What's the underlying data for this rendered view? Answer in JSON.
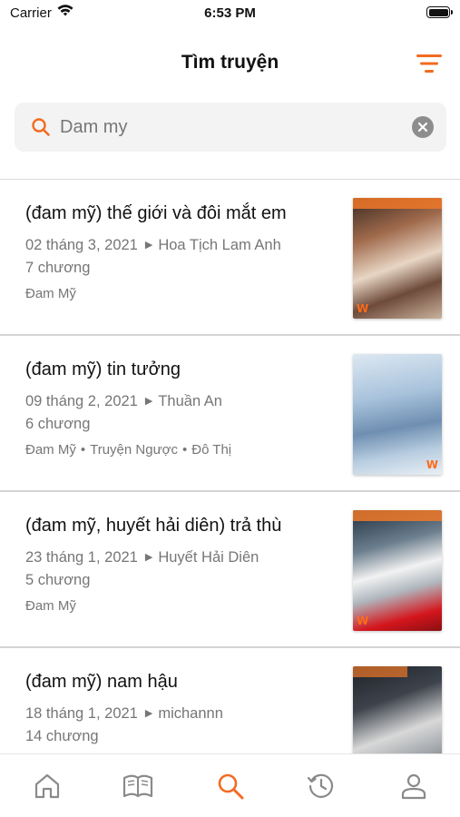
{
  "status_bar": {
    "carrier": "Carrier",
    "time": "6:53 PM"
  },
  "header": {
    "title": "Tìm truyện",
    "filter_icon": "filter-lines-icon"
  },
  "search": {
    "query": "Dam my",
    "placeholder": "Tìm truyện",
    "search_icon": "search-icon",
    "clear_icon": "clear-icon"
  },
  "results": [
    {
      "title": "(đam mỹ) thế giới và đôi mắt em",
      "date": "02 tháng 3, 2021",
      "author": "Hoa Tịch Lam Anh",
      "chapters": "7 chương",
      "tags": [
        "Đam Mỹ"
      ]
    },
    {
      "title": "(đam mỹ) tin tưởng",
      "date": "09 tháng 2, 2021",
      "author": "Thuần An",
      "chapters": "6 chương",
      "tags": [
        "Đam Mỹ",
        "Truyện Ngược",
        "Đô Thị"
      ]
    },
    {
      "title": "(đam mỹ, huyết hải diên) trả thù",
      "date": "23 tháng 1, 2021",
      "author": "Huyết Hải Diên",
      "chapters": "5 chương",
      "tags": [
        "Đam Mỹ"
      ]
    },
    {
      "title": "(đam mỹ) nam hậu",
      "date": "18 tháng 1, 2021",
      "author": "michannn",
      "chapters": "14 chương",
      "tags": []
    }
  ],
  "tab_bar": {
    "items": [
      {
        "icon": "home-icon",
        "active": false
      },
      {
        "icon": "book-icon",
        "active": false
      },
      {
        "icon": "search-icon",
        "active": true
      },
      {
        "icon": "history-icon",
        "active": false
      },
      {
        "icon": "profile-icon",
        "active": false
      }
    ]
  },
  "colors": {
    "accent": "#f26b21",
    "tab_inactive": "#8a8a8a",
    "meta_text": "#767676"
  }
}
